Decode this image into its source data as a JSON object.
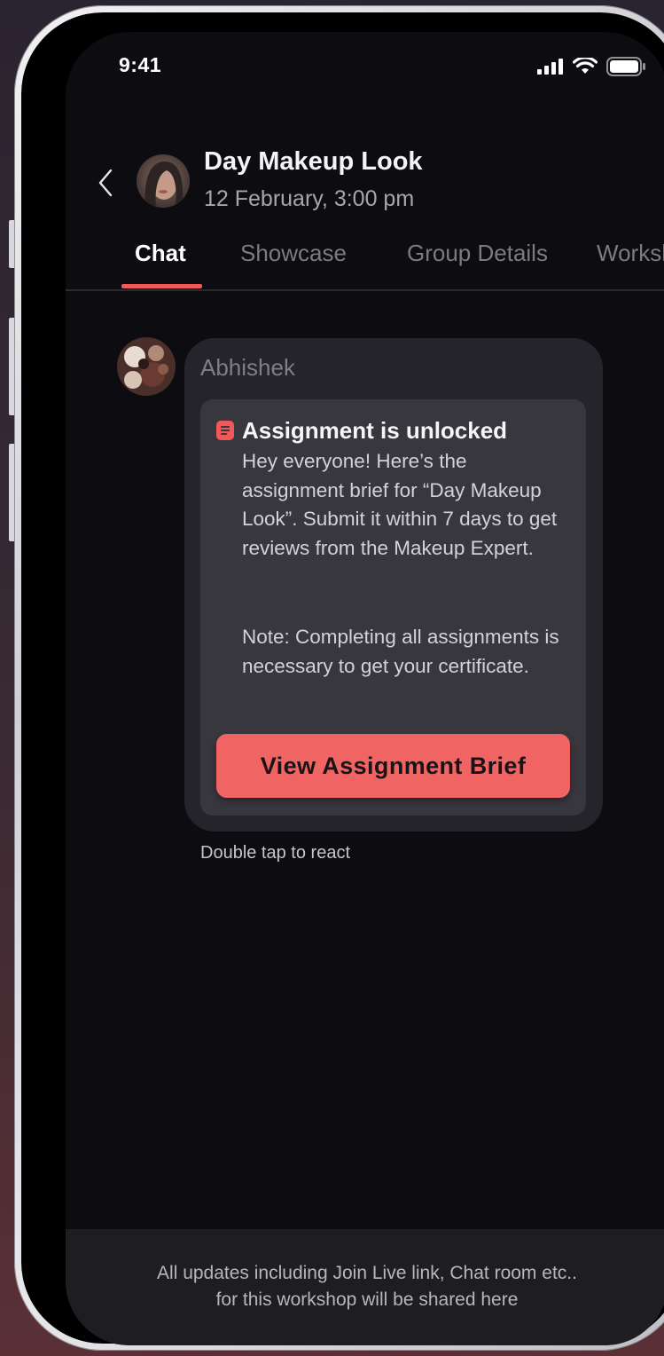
{
  "status_bar": {
    "time": "9:41",
    "icons": [
      "signal-icon",
      "wifi-icon",
      "battery-icon"
    ]
  },
  "header": {
    "back_icon": "chevron-left-icon",
    "title": "Day Makeup Look",
    "subtitle": "12 February, 3:00 pm"
  },
  "tabs": [
    {
      "label": "Chat",
      "active": true
    },
    {
      "label": "Showcase",
      "active": false
    },
    {
      "label": "Group Details",
      "active": false
    },
    {
      "label": "Workshop",
      "active": false
    }
  ],
  "message": {
    "sender": "Abhishek",
    "card": {
      "icon": "document-icon",
      "title": "Assignment is unlocked",
      "body": "Hey everyone! Here’s the assignment brief for “Day Makeup Look”. Submit it within 7 days to get reviews from the Makeup Expert.",
      "note": "Note: Completing all assignments is necessary to get your certificate.",
      "cta_label": "View Assignment Brief"
    },
    "react_hint": "Double tap to react"
  },
  "footer": {
    "line1": "All updates including Join Live link, Chat room etc..",
    "line2": "for this workshop will be shared here"
  },
  "colors": {
    "accent": "#f0585a",
    "background": "#0d0c10",
    "bubble": "#25242a",
    "card": "#38373e"
  }
}
